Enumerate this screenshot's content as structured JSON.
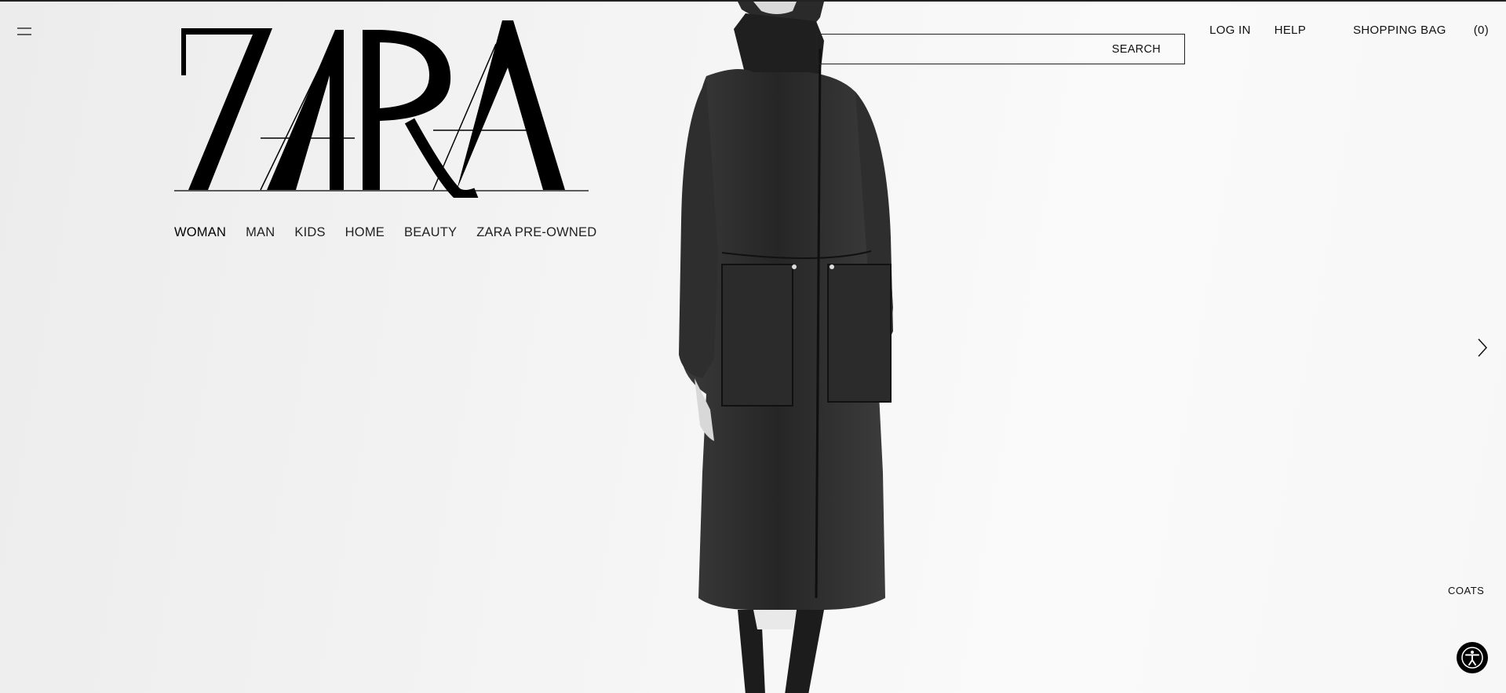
{
  "brand": {
    "logo_text": "ZARA"
  },
  "header": {
    "menu_icon": "hamburger-menu-icon",
    "search": {
      "label": "SEARCH"
    },
    "links": {
      "login": "LOG IN",
      "help": "HELP",
      "bag_label": "SHOPPING BAG",
      "bag_count": "(0)"
    }
  },
  "nav": {
    "items": [
      {
        "label": "WOMAN",
        "active": true
      },
      {
        "label": "MAN"
      },
      {
        "label": "KIDS"
      },
      {
        "label": "HOME"
      },
      {
        "label": "BEAUTY"
      },
      {
        "label": "ZARA PRE-OWNED"
      }
    ]
  },
  "hero": {
    "caption": "COATS",
    "next_icon": "chevron-right-icon"
  },
  "accessibility": {
    "icon": "accessibility-icon"
  },
  "colors": {
    "text": "#111111",
    "background": "#f2f2f2",
    "accent": "#000000"
  }
}
